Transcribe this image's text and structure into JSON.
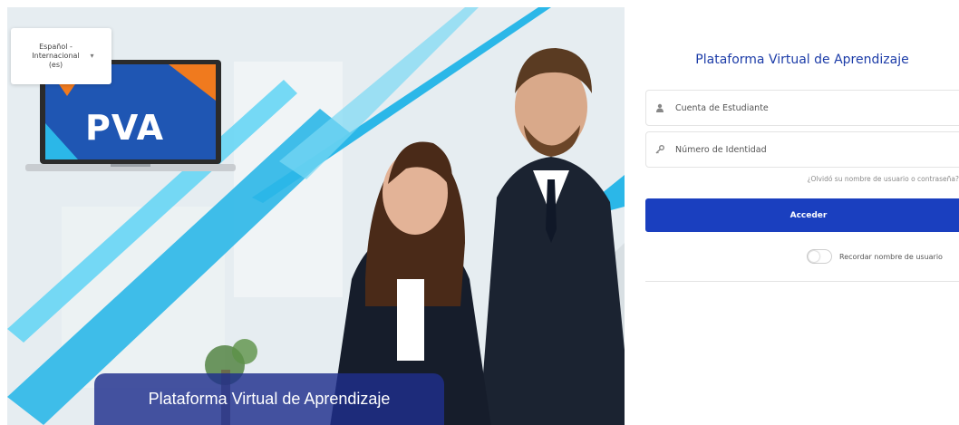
{
  "language_select": {
    "label": "Español - Internacional (es)"
  },
  "hero": {
    "logo_text": "PVA",
    "caption": "Plataforma Virtual de Aprendizaje"
  },
  "login": {
    "title": "Plataforma Virtual de Aprendizaje",
    "username_placeholder": "Cuenta de Estudiante",
    "password_placeholder": "Número de Identidad",
    "forgot_link": "¿Olvidó su nombre de usuario o contraseña?",
    "submit_label": "Acceder",
    "remember_label": "Recordar nombre de usuario"
  },
  "colors": {
    "brand_blue": "#1a3fbf",
    "title_blue": "#1c3ca8",
    "accent_cyan": "#2bb7e8",
    "logo_orange": "#f07a1e"
  }
}
